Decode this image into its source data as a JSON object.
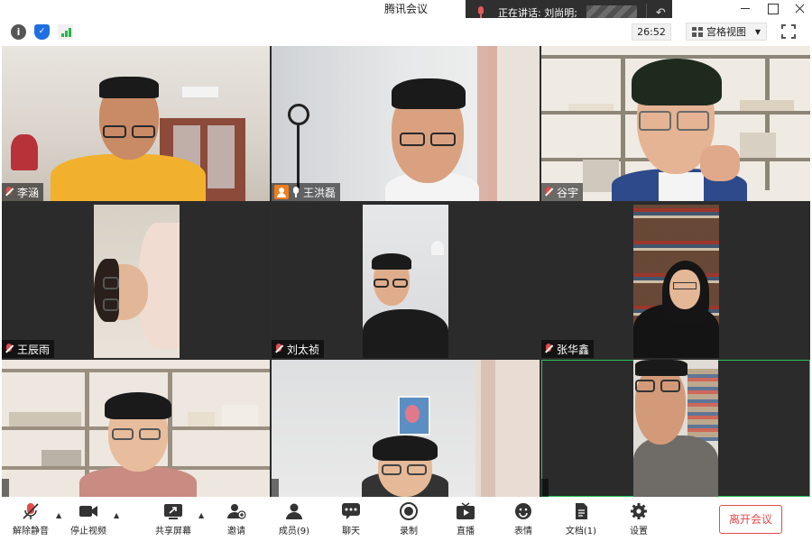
{
  "window": {
    "title": "腾讯会议"
  },
  "speaking": {
    "label": "正在讲话: 刘尚明;"
  },
  "infobar": {
    "timer": "26:52",
    "view_mode": "宫格视图"
  },
  "participants": [
    {
      "name": "李涵",
      "icon": "mic-muted-icon"
    },
    {
      "name": "王洪磊",
      "icon": "mic-on-icon",
      "host": true
    },
    {
      "name": "谷宇",
      "icon": "mic-muted-icon"
    },
    {
      "name": "王辰雨",
      "icon": "mic-muted-icon"
    },
    {
      "name": "刘太祯",
      "icon": "mic-muted-icon"
    },
    {
      "name": "张华鑫",
      "icon": "mic-muted-icon"
    },
    {
      "name": "",
      "icon": ""
    },
    {
      "name": "",
      "icon": ""
    },
    {
      "name": "",
      "icon": ""
    }
  ],
  "toolbar": {
    "unmute": "解除静音",
    "stop_video": "停止视频",
    "share_screen": "共享屏幕",
    "invite": "邀请",
    "members": "成员(9)",
    "chat": "聊天",
    "record": "录制",
    "live": "直播",
    "reactions": "表情",
    "docs": "文档(1)",
    "settings": "设置",
    "leave": "离开会议"
  },
  "colors": {
    "leave": "#e34b4b",
    "active_border": "#29c35c",
    "host_badge": "#f07c1c",
    "signal": "#27b44a"
  }
}
